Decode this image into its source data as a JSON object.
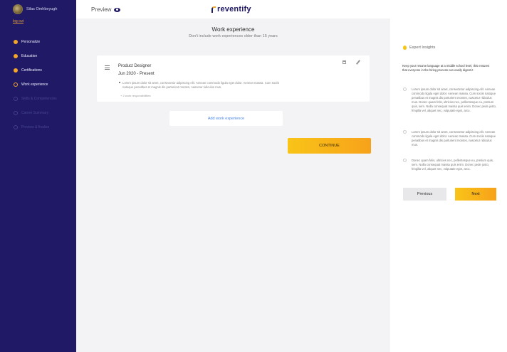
{
  "sidebar": {
    "user_name": "Silas Omhbeyugh",
    "logout_label": "log out",
    "steps": [
      {
        "label": "Personalize",
        "state": "done"
      },
      {
        "label": "Education",
        "state": "done"
      },
      {
        "label": "Certifications",
        "state": "done"
      },
      {
        "label": "Work experience",
        "state": "current"
      },
      {
        "label": "Skills & Competencies",
        "state": "upcoming"
      },
      {
        "label": "Career Summary",
        "state": "upcoming"
      },
      {
        "label": "Preview & finalize",
        "state": "upcoming"
      }
    ]
  },
  "header": {
    "preview_label": "Preview",
    "brand": "reventify"
  },
  "main": {
    "title": "Work experience",
    "subtitle": "Don't include work experiences older than 15 years",
    "entry": {
      "job_title": "Product Designer",
      "dates": "Jun 2020 - Present",
      "responsibility": "Lorem ipsum dolor sit amet, consectetur adipiscing elit. Aenean commodo ligula eget dolor. Aenean massa. Cum sociis natoque penatibus et magnis dis parturient montes, nascetur ridiculus mus.",
      "more_label": "+ 2 work responsibilities"
    },
    "add_label": "Add work experience",
    "continue_label": "CONTINUE"
  },
  "insights": {
    "title": "Expert Insights",
    "intro": "Keep your resume language at a middle school level, this ensures that everyone in the hiring process can easily digest it",
    "tips": [
      "Lorem ipsum dolor sit amet, consectetur adipiscing elit. Aenean commodo ligula eget dolor. Aenean massa. Cum sociis natoque penatibus et magnis dis parturient montes, nascetur ridiculus mus. Donec quam felis, ultricies nec, pellentesque eu, pretium quis, sem. Nulla consequat massa quis enim. Donec pede justo, fringilla vel, aliquet nec, vulputate eget, arcu.",
      "Lorem ipsum dolor sit amet, consectetur adipiscing elit. Aenean commodo ligula eget dolor. Aenean massa. Cum sociis natoque penatibus et magnis dis parturient montes, nascetur ridiculus mus.",
      "Donec quam felis, ultricies nec, pellentesque eu, pretium quis, sem. Nulla consequat massa quis enim. Donec pede justo, fringilla vel, aliquet nec, vulputate eget, arcu."
    ],
    "prev_label": "Previous",
    "next_label": "Next"
  },
  "colors": {
    "sidebar_bg": "#1f1966",
    "accent": "#f5a623",
    "link": "#4a86e8"
  }
}
